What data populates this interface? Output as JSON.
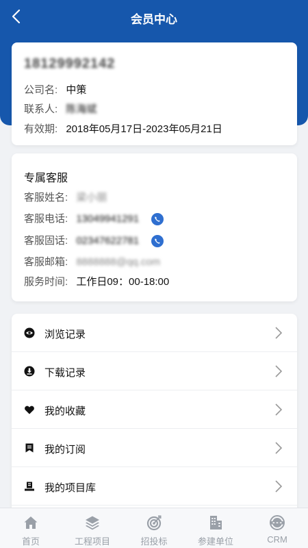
{
  "header": {
    "title": "会员中心"
  },
  "member": {
    "account": "18129992142",
    "company_label": "公司名:",
    "company_value": "中策",
    "contact_label": "联系人:",
    "contact_value": "陈海斌",
    "validity_label": "有效期:",
    "validity_value": "2018年05月17日-2023年05月21日"
  },
  "service": {
    "title": "专属客服",
    "name_label": "客服姓名:",
    "name_value": "梁小丽",
    "phone_label": "客服电话:",
    "phone_value": "13049941291",
    "landline_label": "客服固话:",
    "landline_value": "02347622781",
    "email_label": "客服邮箱:",
    "email_value": "8888888@qq.com",
    "hours_label": "服务时间:",
    "hours_value": "工作日09：00-18:00"
  },
  "menu": [
    {
      "label": "浏览记录",
      "icon": "eye-icon"
    },
    {
      "label": "下载记录",
      "icon": "download-icon"
    },
    {
      "label": "我的收藏",
      "icon": "heart-icon"
    },
    {
      "label": "我的订阅",
      "icon": "bookmark-icon"
    },
    {
      "label": "我的项目库",
      "icon": "project-library-icon"
    }
  ],
  "tabs": [
    {
      "label": "首页",
      "icon": "home-icon"
    },
    {
      "label": "工程项目",
      "icon": "layers-icon"
    },
    {
      "label": "招投标",
      "icon": "target-icon"
    },
    {
      "label": "参建单位",
      "icon": "building-icon"
    },
    {
      "label": "CRM",
      "icon": "crm-icon"
    }
  ],
  "colors": {
    "primary": "#1657ac",
    "link": "#2f6fd0",
    "tab_inactive": "#9aa0a8"
  }
}
